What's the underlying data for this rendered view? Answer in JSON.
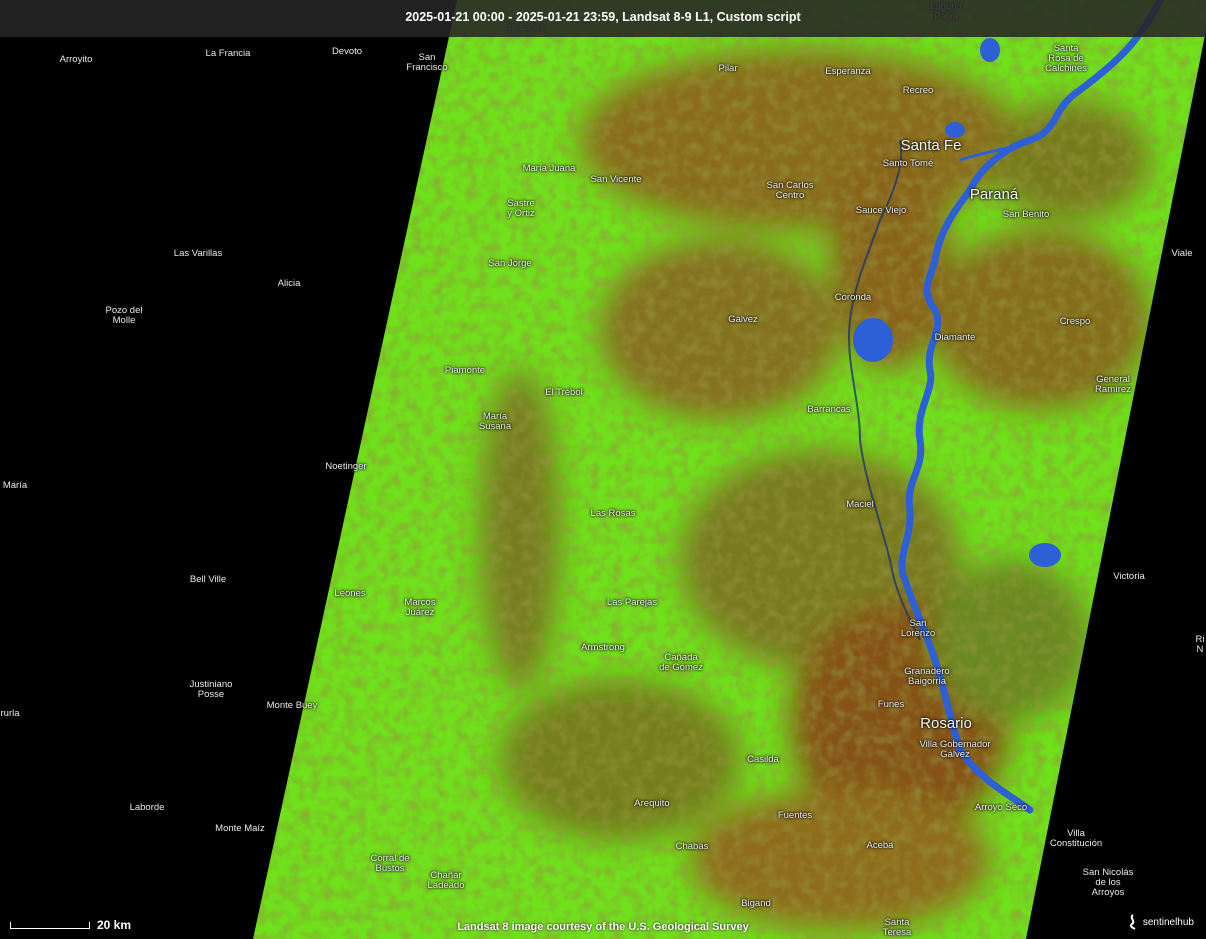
{
  "header": {
    "title": "2025-01-21 00:00 - 2025-01-21 23:59, Landsat 8-9 L1, Custom script"
  },
  "footer": {
    "attribution": "Landsat 8 image courtesy of the U.S. Geological Survey",
    "scale": "20 km",
    "logo": "sentinelhub"
  },
  "colors": {
    "vegetation": "#6fe01b",
    "bare_soil": "#9a5a1c",
    "water": "#2a5bd0",
    "background": "#000000"
  },
  "places": [
    {
      "name": "Laguna\nPaiva"
    },
    {
      "name": "de Santa"
    },
    {
      "name": "Arroyito"
    },
    {
      "name": "La Francia"
    },
    {
      "name": "Devoto"
    },
    {
      "name": "San\nFrancisco"
    },
    {
      "name": "Pilar"
    },
    {
      "name": "Esperanza"
    },
    {
      "name": "Recreo"
    },
    {
      "name": "Santa\nRosa de\nCalchines"
    },
    {
      "name": "Santa Fe",
      "size": "big"
    },
    {
      "name": "Santo Tomé"
    },
    {
      "name": "María Juana"
    },
    {
      "name": "San Vicente"
    },
    {
      "name": "San Carlos\nCentro"
    },
    {
      "name": "Paraná",
      "size": "big"
    },
    {
      "name": "Sastre\ny Ortiz"
    },
    {
      "name": "Sauce Viejo"
    },
    {
      "name": "San Benito"
    },
    {
      "name": "Las Varillas"
    },
    {
      "name": "Viale"
    },
    {
      "name": "San Jorge"
    },
    {
      "name": "Alicia"
    },
    {
      "name": "Coronda"
    },
    {
      "name": "Pozo del\nMolle"
    },
    {
      "name": "Gálvez"
    },
    {
      "name": "Crespo"
    },
    {
      "name": "Diamante"
    },
    {
      "name": "Piamonte"
    },
    {
      "name": "El Trébol"
    },
    {
      "name": "General\nRamírez"
    },
    {
      "name": "Barrancas"
    },
    {
      "name": "María\nSusana"
    },
    {
      "name": "Noetinger"
    },
    {
      "name": "María"
    },
    {
      "name": "Maciel"
    },
    {
      "name": "Las Rosas"
    },
    {
      "name": "Bell Ville"
    },
    {
      "name": "Victoria"
    },
    {
      "name": "Leones"
    },
    {
      "name": "Marcos\nJuárez"
    },
    {
      "name": "Las Parejas"
    },
    {
      "name": "San\nLorenzo"
    },
    {
      "name": "Ri\nN"
    },
    {
      "name": "Armstrong"
    },
    {
      "name": "Cañada\nde Gómez"
    },
    {
      "name": "Granadero\nBaigorria"
    },
    {
      "name": "Justiniano\nPosse"
    },
    {
      "name": "Funes"
    },
    {
      "name": "Monte Buey"
    },
    {
      "name": "rurla"
    },
    {
      "name": "Rosario",
      "size": "big"
    },
    {
      "name": "Villa Gobernador\nGálvez"
    },
    {
      "name": "Casilda"
    },
    {
      "name": "Laborde"
    },
    {
      "name": "Arequito"
    },
    {
      "name": "Arroyo Seco"
    },
    {
      "name": "Monte Maíz"
    },
    {
      "name": "Fuentes"
    },
    {
      "name": "Villa\nConstitución"
    },
    {
      "name": "Chabás"
    },
    {
      "name": "Aceba"
    },
    {
      "name": "Corral de\nBustos"
    },
    {
      "name": "San Nicolás\nde los\nArroyos"
    },
    {
      "name": "Chañar\nLadeado"
    },
    {
      "name": "Bigand"
    },
    {
      "name": "Santa\nTeresa"
    }
  ]
}
